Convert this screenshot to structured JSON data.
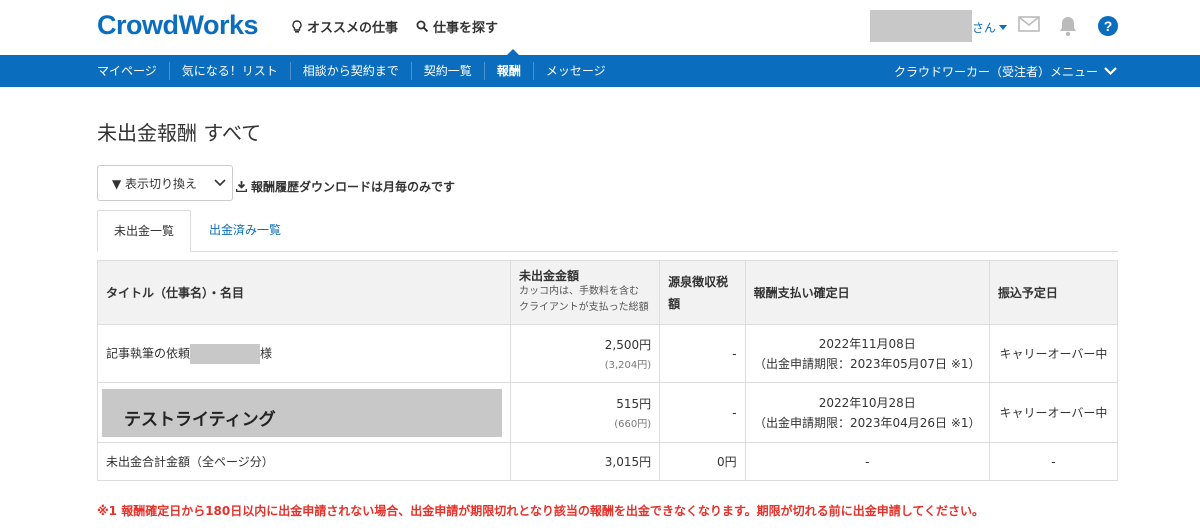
{
  "header": {
    "logo": "CrowdWorks",
    "links": [
      {
        "label": "オススメの仕事",
        "icon": "lightbulb-icon"
      },
      {
        "label": "仕事を探す",
        "icon": "search-icon"
      }
    ],
    "user_suffix": "さん",
    "icons": [
      "mail-icon",
      "bell-icon",
      "help-icon"
    ]
  },
  "nav": {
    "items": [
      "マイページ",
      "気になる！リスト",
      "相談から契約まで",
      "契約一覧",
      "報酬",
      "メッセージ"
    ],
    "active": "報酬",
    "right_menu": "クラウドワーカー（受注者）メニュー"
  },
  "page": {
    "title": "未出金報酬 すべて",
    "switch_label": "▼ 表示切り換え",
    "download_note": "報酬履歴ダウンロードは月毎のみです",
    "tabs": [
      "未出金一覧",
      "出金済み一覧"
    ]
  },
  "table": {
    "headers": {
      "title": "タイトル（仕事名）・名目",
      "amount": "未出金金額",
      "amount_sub1": "カッコ内は、手数料を含む",
      "amount_sub2": "クライアントが支払った総額",
      "tax": "源泉徴収税額",
      "confirm_date": "報酬支払い確定日",
      "transfer_date": "振込予定日"
    },
    "rows": [
      {
        "title_prefix": "記事執筆の依頼",
        "title_suffix": "様",
        "amount": "2,500円",
        "gross": "(3,204円)",
        "tax": "-",
        "date": "2022年11月08日",
        "deadline": "（出金申請期限：2023年05月07日 ※1）",
        "transfer": "キャリーオーバー中"
      },
      {
        "title": "テストライティング",
        "amount": "515円",
        "gross": "(660円)",
        "tax": "-",
        "date": "2022年10月28日",
        "deadline": "（出金申請期限：2023年04月26日 ※1）",
        "transfer": "キャリーオーバー中"
      }
    ],
    "total": {
      "label": "未出金合計金額（全ページ分）",
      "amount": "3,015円",
      "tax": "0円",
      "date": "-",
      "transfer": "-"
    }
  },
  "footnote": "※1 報酬確定日から180日以内に出金申請されない場合、出金申請が期限切れとなり該当の報酬を出金できなくなります。期限が切れる前に出金申請してください。",
  "colors": {
    "brand": "#0b6dbd",
    "alert": "#e4322b",
    "header_bg": "#f2f2f2"
  }
}
